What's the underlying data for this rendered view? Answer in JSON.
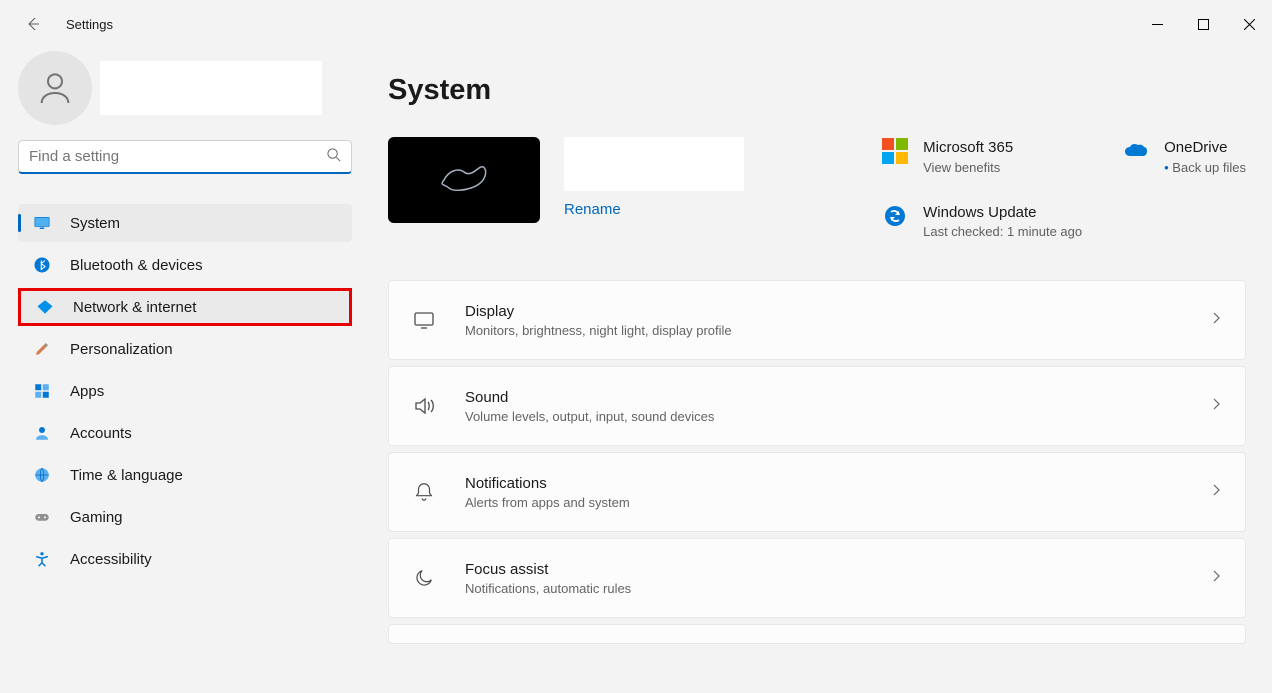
{
  "window": {
    "title": "Settings"
  },
  "search": {
    "placeholder": "Find a setting"
  },
  "nav": {
    "items": [
      {
        "label": "System",
        "icon": "monitor-icon",
        "active": true
      },
      {
        "label": "Bluetooth & devices",
        "icon": "bluetooth-icon"
      },
      {
        "label": "Network & internet",
        "icon": "wifi-icon",
        "highlight": true
      },
      {
        "label": "Personalization",
        "icon": "brush-icon"
      },
      {
        "label": "Apps",
        "icon": "apps-icon"
      },
      {
        "label": "Accounts",
        "icon": "person-icon"
      },
      {
        "label": "Time & language",
        "icon": "globe-icon"
      },
      {
        "label": "Gaming",
        "icon": "gamepad-icon"
      },
      {
        "label": "Accessibility",
        "icon": "accessibility-icon"
      }
    ]
  },
  "page": {
    "title": "System",
    "rename": "Rename"
  },
  "info": {
    "ms365": {
      "title": "Microsoft 365",
      "sub": "View benefits"
    },
    "onedrive": {
      "title": "OneDrive",
      "sub": "Back up files"
    },
    "update": {
      "title": "Windows Update",
      "sub": "Last checked: 1 minute ago"
    }
  },
  "cards": [
    {
      "icon": "display-icon",
      "title": "Display",
      "sub": "Monitors, brightness, night light, display profile"
    },
    {
      "icon": "sound-icon",
      "title": "Sound",
      "sub": "Volume levels, output, input, sound devices"
    },
    {
      "icon": "bell-icon",
      "title": "Notifications",
      "sub": "Alerts from apps and system"
    },
    {
      "icon": "moon-icon",
      "title": "Focus assist",
      "sub": "Notifications, automatic rules"
    }
  ]
}
